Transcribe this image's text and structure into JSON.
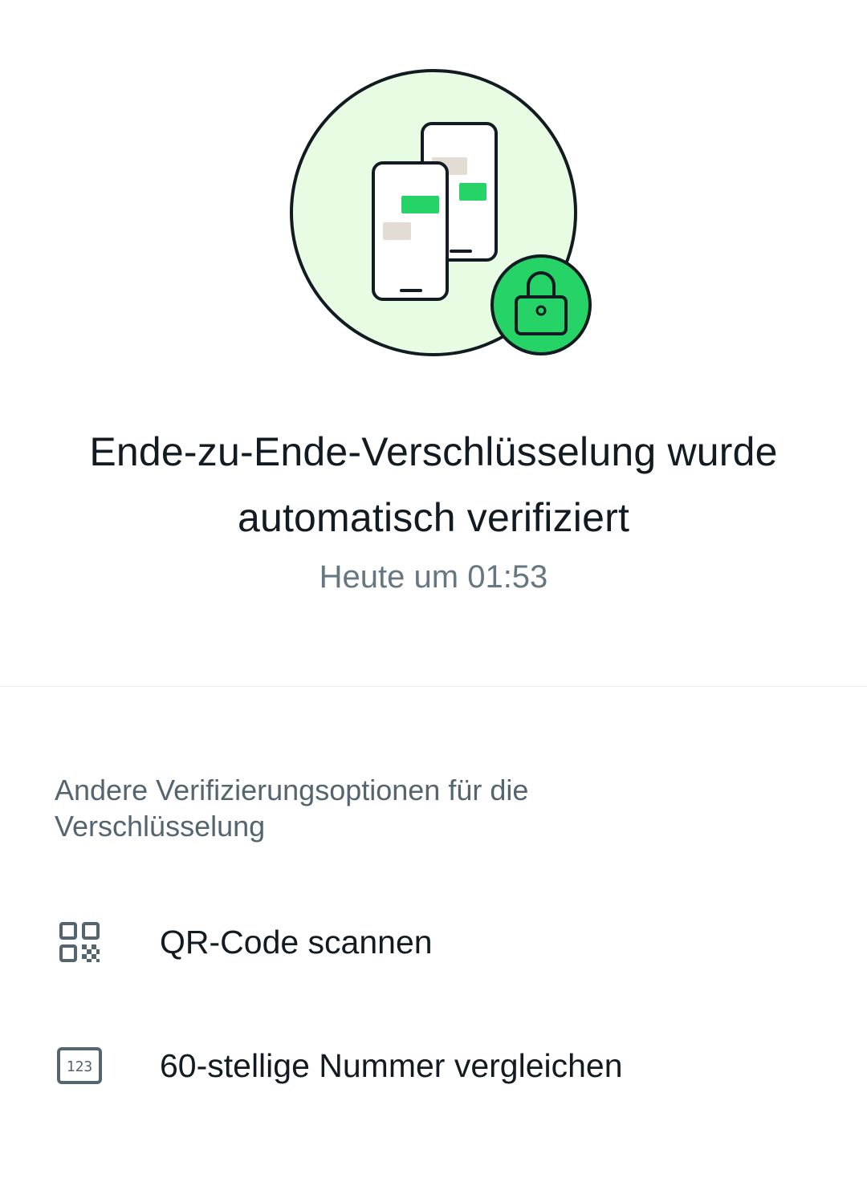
{
  "header": {
    "illustration_icon": "phones-with-lock-illustration",
    "title": "Ende-zu-Ende-Verschlüsselung wurde automatisch verifiziert",
    "timestamp": "Heute um 01:53"
  },
  "options": {
    "section_title": "Andere Verifizierungsoptionen für die Verschlüsselung",
    "items": [
      {
        "icon": "qr-code-icon",
        "label": "QR-Code scannen"
      },
      {
        "icon": "number-123-icon",
        "icon_text": "123",
        "label": "60-stellige Nummer vergleichen"
      }
    ]
  },
  "colors": {
    "accent_green": "#25d366",
    "light_green_bg": "#e7fce3",
    "text_primary": "#111b21",
    "text_secondary": "#667781",
    "icon_gray": "#54656f"
  }
}
